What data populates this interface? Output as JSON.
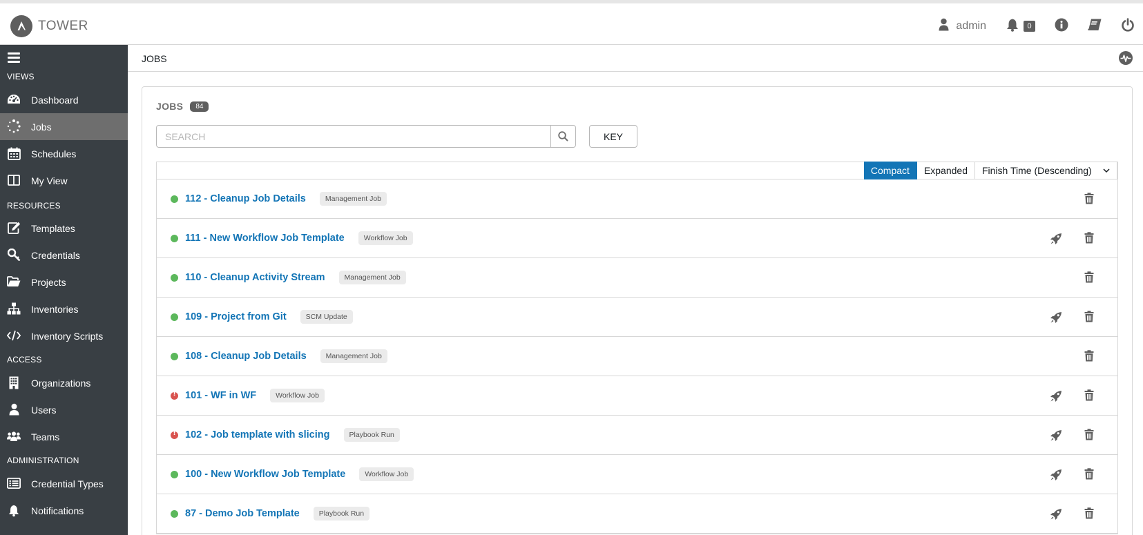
{
  "app": {
    "brand": "TOWER"
  },
  "topbar": {
    "user": "admin",
    "notification_count": "0",
    "icons": [
      "user-icon",
      "bell-icon",
      "info-icon",
      "docs-icon",
      "power-icon"
    ]
  },
  "sidebar": {
    "sections": [
      {
        "label": "VIEWS",
        "items": [
          {
            "label": "Dashboard",
            "icon": "dashboard-icon"
          },
          {
            "label": "Jobs",
            "icon": "jobs-icon",
            "active": true
          },
          {
            "label": "Schedules",
            "icon": "calendar-icon"
          },
          {
            "label": "My View",
            "icon": "columns-icon"
          }
        ]
      },
      {
        "label": "RESOURCES",
        "items": [
          {
            "label": "Templates",
            "icon": "edit-icon"
          },
          {
            "label": "Credentials",
            "icon": "key-icon"
          },
          {
            "label": "Projects",
            "icon": "folder-icon"
          },
          {
            "label": "Inventories",
            "icon": "sitemap-icon"
          },
          {
            "label": "Inventory Scripts",
            "icon": "code-icon"
          }
        ]
      },
      {
        "label": "ACCESS",
        "items": [
          {
            "label": "Organizations",
            "icon": "building-icon"
          },
          {
            "label": "Users",
            "icon": "user-icon"
          },
          {
            "label": "Teams",
            "icon": "users-icon"
          }
        ]
      },
      {
        "label": "ADMINISTRATION",
        "items": [
          {
            "label": "Credential Types",
            "icon": "list-icon"
          },
          {
            "label": "Notifications",
            "icon": "bell-icon"
          }
        ]
      }
    ]
  },
  "breadcrumb": "JOBS",
  "jobs_panel": {
    "title": "JOBS",
    "count": "84",
    "search_placeholder": "SEARCH",
    "key_label": "KEY",
    "view_compact": "Compact",
    "view_expanded": "Expanded",
    "sort_label": "Finish Time (Descending)"
  },
  "colors": {
    "accent": "#1375b6",
    "success": "#5cb85c",
    "failed": "#d9534f",
    "sidebar": "#393f44"
  },
  "jobs": [
    {
      "title": "112 - Cleanup Job Details",
      "type": "Management Job",
      "status": "successful",
      "relaunch": false
    },
    {
      "title": "111 - New Workflow Job Template",
      "type": "Workflow Job",
      "status": "successful",
      "relaunch": true
    },
    {
      "title": "110 - Cleanup Activity Stream",
      "type": "Management Job",
      "status": "successful",
      "relaunch": false
    },
    {
      "title": "109 - Project from Git",
      "type": "SCM Update",
      "status": "successful",
      "relaunch": true
    },
    {
      "title": "108 - Cleanup Job Details",
      "type": "Management Job",
      "status": "successful",
      "relaunch": false
    },
    {
      "title": "101 - WF in WF",
      "type": "Workflow Job",
      "status": "failed",
      "relaunch": true
    },
    {
      "title": "102 - Job template with slicing",
      "type": "Playbook Run",
      "status": "failed",
      "relaunch": true
    },
    {
      "title": "100 - New Workflow Job Template",
      "type": "Workflow Job",
      "status": "successful",
      "relaunch": true
    },
    {
      "title": "87 - Demo Job Template",
      "type": "Playbook Run",
      "status": "successful",
      "relaunch": true
    }
  ]
}
